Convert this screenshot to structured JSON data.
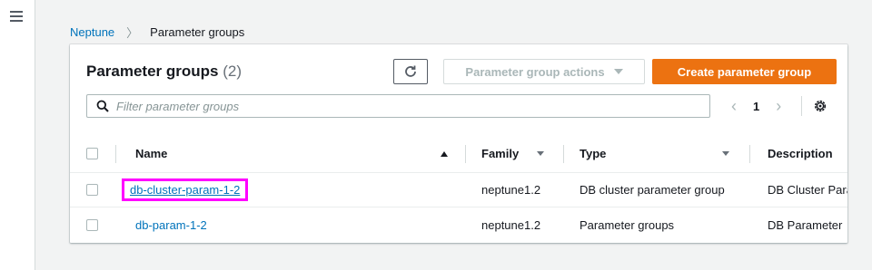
{
  "breadcrumb": {
    "root": "Neptune",
    "current": "Parameter groups"
  },
  "panel": {
    "title": "Parameter groups",
    "count": "(2)"
  },
  "toolbar": {
    "actions_label": "Parameter group actions",
    "create_label": "Create parameter group"
  },
  "filter": {
    "placeholder": "Filter parameter groups"
  },
  "pagination": {
    "page": "1"
  },
  "table": {
    "headers": {
      "name": "Name",
      "family": "Family",
      "type": "Type",
      "description": "Description"
    },
    "rows": [
      {
        "name": "db-cluster-param-1-2",
        "family": "neptune1.2",
        "type": "DB cluster parameter group",
        "description": "DB Cluster Para"
      },
      {
        "name": "db-param-1-2",
        "family": "neptune1.2",
        "type": "Parameter groups",
        "description": "DB Parameter"
      }
    ]
  },
  "colors": {
    "accent": "#ec7211",
    "link": "#0073bb",
    "highlight": "#ff00ff"
  },
  "icons": {
    "menu": "hamburger-icon",
    "refresh": "refresh-icon",
    "search": "search-icon",
    "settings": "gear-icon"
  }
}
